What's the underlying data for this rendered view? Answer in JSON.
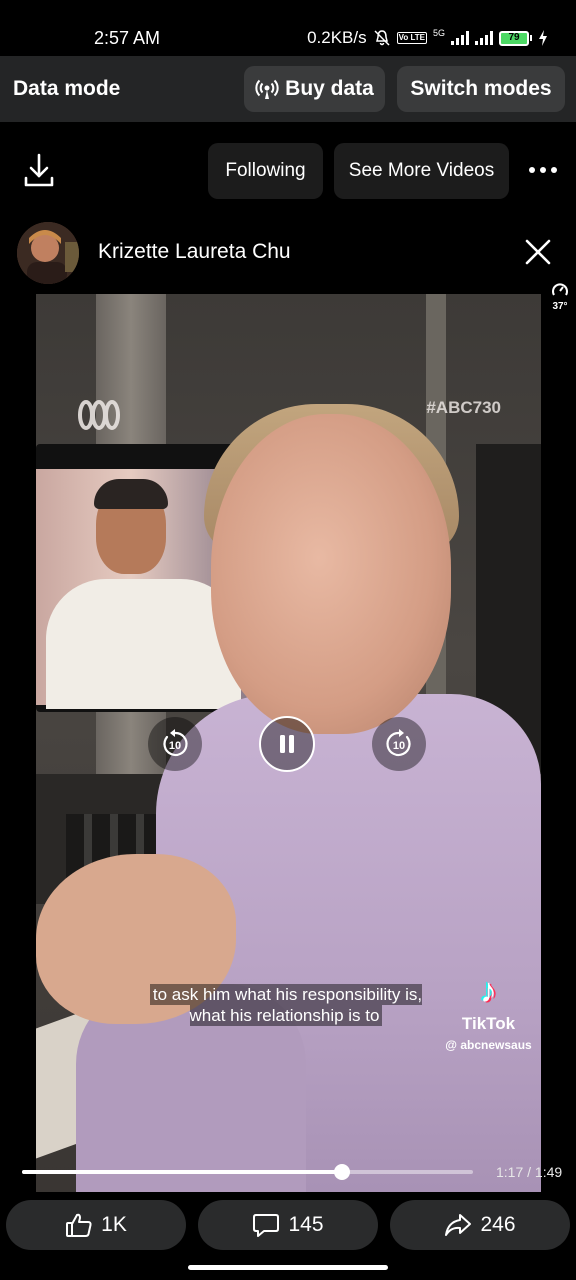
{
  "status_bar": {
    "time": "2:57 AM",
    "net_speed": "0.2KB/s",
    "network": "5G",
    "volte": "Vo LTE",
    "battery": "79"
  },
  "data_mode_bar": {
    "title": "Data mode",
    "buy_data_label": "Buy data",
    "switch_modes_label": "Switch modes"
  },
  "top_actions": {
    "following_label": "Following",
    "see_more_label": "See More Videos"
  },
  "author": {
    "name": "Krizette Laureta Chu"
  },
  "speed_indicator": "37°",
  "video": {
    "watermark_tag": "#ABC730",
    "subtitle": "to ask him what his responsibility is, what his relationship is to",
    "tiktok_name": "TikTok",
    "tiktok_handle": "@ abcnewsaus",
    "rewind_seconds": "10",
    "forward_seconds": "10",
    "progress_fraction": 0.709,
    "time_label": "1:17 / 1:49"
  },
  "reactions": {
    "likes": "1K",
    "comments": "145",
    "shares": "246"
  },
  "icons": {
    "download": "download-icon",
    "more": "more-dots-icon",
    "close": "close-icon",
    "antenna": "antenna-icon",
    "like": "thumbs-up-icon",
    "comment": "comment-icon",
    "share": "share-icon"
  }
}
